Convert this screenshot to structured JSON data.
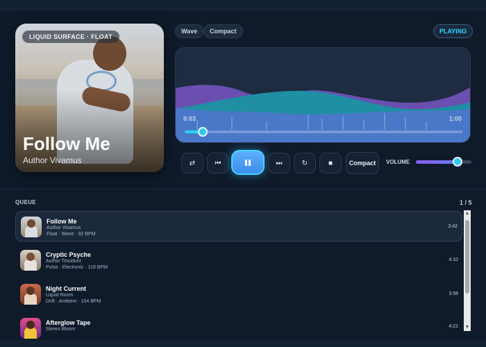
{
  "cover": {
    "badge": "LIQUID SURFACE · FLOAT",
    "title": "Follow Me",
    "artist": "Author Vivamus"
  },
  "view_pills": [
    {
      "label": "Wave"
    },
    {
      "label": "Compact"
    }
  ],
  "status": "PLAYING",
  "player": {
    "current_time": "0:03",
    "total_time": "1:00",
    "progress": 0.05
  },
  "controls": {
    "shuffle_icon": "shuffle-icon",
    "prev_icon": "skip-back-icon",
    "play_icon": "pause-icon",
    "next_icon": "skip-forward-icon",
    "repeat_icon": "repeat-icon",
    "stop_icon": "stop-icon",
    "compact_label": "Compact",
    "volume_label": "VOLUME",
    "volume": 0.75
  },
  "queue": {
    "label": "QUEUE",
    "count": "1 / 5",
    "items": [
      {
        "title": "Follow Me",
        "artist": "Author Vivamus",
        "meta": "Float · Wave · 92 BPM",
        "duration": "3:42"
      },
      {
        "title": "Cryptic Psyche",
        "artist": "Author Tincidunt",
        "meta": "Pulse · Electronic · 118 BPM",
        "duration": "4:10"
      },
      {
        "title": "Night Current",
        "artist": "Liquid Room",
        "meta": "Drift · Ambient · 104 BPM",
        "duration": "3:58"
      },
      {
        "title": "Afterglow Tape",
        "artist": "Stereo Bloom",
        "meta": "",
        "duration": "4:21"
      }
    ]
  },
  "colors": {
    "accent": "#2ad4f5",
    "wave_purple": "#6a4fb0",
    "wave_teal": "#1f8fa3",
    "wave_blue": "#4a78c8"
  }
}
